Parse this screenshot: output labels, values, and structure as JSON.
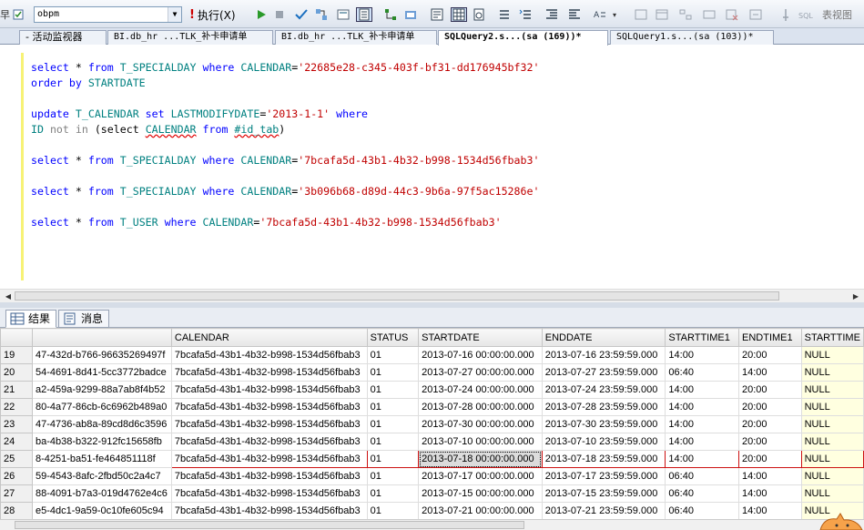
{
  "toolbar": {
    "left_glyph": "早",
    "database": "obpm",
    "execute_label": "执行(X)",
    "show_schema_label": "表视图"
  },
  "tabs": [
    {
      "label": "- 活动监视器",
      "active": false
    },
    {
      "label": "BI.db_hr ...TLK_补卡申请单",
      "active": false
    },
    {
      "label": "BI.db_hr ...TLK_补卡申请单",
      "active": false
    },
    {
      "label": "SQLQuery2.s...(sa (169))*",
      "active": true
    },
    {
      "label": "SQLQuery1.s...(sa (103))*",
      "active": false
    }
  ],
  "code_lines": [
    [
      [
        "kw",
        "select"
      ],
      [
        "",
        "*"
      ],
      [
        "kw",
        "from"
      ],
      [
        "id",
        "T_SPECIALDAY"
      ],
      [
        "kw",
        "where"
      ],
      [
        "id",
        "CALENDAR"
      ],
      [
        "",
        "="
      ],
      [
        "str",
        "'22685e28-c345-403f-bf31-dd176945bf32'"
      ]
    ],
    [
      [
        "kw",
        "order by"
      ],
      [
        "id",
        "STARTDATE"
      ]
    ],
    [],
    [
      [
        "kw",
        "update"
      ],
      [
        "id",
        "T_CALENDAR"
      ],
      [
        "kw",
        "set"
      ],
      [
        "id",
        "LASTMODIFYDATE"
      ],
      [
        "",
        "="
      ],
      [
        "str",
        "'2013-1-1'"
      ],
      [
        "kw",
        "where"
      ]
    ],
    [
      [
        "id",
        "ID"
      ],
      [
        "gr",
        "not in"
      ],
      [
        "",
        "(select"
      ],
      [
        "sqid",
        "CALENDAR"
      ],
      [
        "kw",
        "from"
      ],
      [
        "sqid",
        "#id_tab"
      ],
      [
        "",
        ")"
      ]
    ],
    [],
    [
      [
        "kw",
        "select"
      ],
      [
        "",
        "*"
      ],
      [
        "kw",
        "from"
      ],
      [
        "id",
        "T_SPECIALDAY"
      ],
      [
        "kw",
        "where"
      ],
      [
        "id",
        "CALENDAR"
      ],
      [
        "",
        "="
      ],
      [
        "str",
        "'7bcafa5d-43b1-4b32-b998-1534d56fbab3'"
      ]
    ],
    [],
    [
      [
        "kw",
        "select"
      ],
      [
        "",
        "*"
      ],
      [
        "kw",
        "from"
      ],
      [
        "id",
        "T_SPECIALDAY"
      ],
      [
        "kw",
        "where"
      ],
      [
        "id",
        "CALENDAR"
      ],
      [
        "",
        "="
      ],
      [
        "str",
        "'3b096b68-d89d-44c3-9b6a-97f5ac15286e'"
      ]
    ],
    [],
    [
      [
        "kw",
        "select"
      ],
      [
        "",
        "*"
      ],
      [
        "kw",
        "from"
      ],
      [
        "id",
        "T_USER"
      ],
      [
        "kw",
        "where"
      ],
      [
        "id",
        "CALENDAR"
      ],
      [
        "",
        "="
      ],
      [
        "str",
        "'7bcafa5d-43b1-4b32-b998-1534d56fbab3'"
      ]
    ]
  ],
  "results_tabs": {
    "results": "结果",
    "messages": "消息"
  },
  "grid": {
    "columns": [
      "",
      "CALENDAR",
      "STATUS",
      "STARTDATE",
      "ENDDATE",
      "STARTTIME1",
      "ENDTIME1",
      "STARTTIME"
    ],
    "rows": [
      [
        "19",
        "47-432d-b766-96635269497f",
        "7bcafa5d-43b1-4b32-b998-1534d56fbab3",
        "01",
        "2013-07-16 00:00:00.000",
        "2013-07-16 23:59:59.000",
        "14:00",
        "20:00",
        "NULL"
      ],
      [
        "20",
        "54-4691-8d41-5cc3772badce",
        "7bcafa5d-43b1-4b32-b998-1534d56fbab3",
        "01",
        "2013-07-27 00:00:00.000",
        "2013-07-27 23:59:59.000",
        "06:40",
        "14:00",
        "NULL"
      ],
      [
        "21",
        "a2-459a-9299-88a7ab8f4b52",
        "7bcafa5d-43b1-4b32-b998-1534d56fbab3",
        "01",
        "2013-07-24 00:00:00.000",
        "2013-07-24 23:59:59.000",
        "14:00",
        "20:00",
        "NULL"
      ],
      [
        "22",
        "80-4a77-86cb-6c6962b489a0",
        "7bcafa5d-43b1-4b32-b998-1534d56fbab3",
        "01",
        "2013-07-28 00:00:00.000",
        "2013-07-28 23:59:59.000",
        "14:00",
        "20:00",
        "NULL"
      ],
      [
        "23",
        "47-4736-ab8a-89cd8d6c3596",
        "7bcafa5d-43b1-4b32-b998-1534d56fbab3",
        "01",
        "2013-07-30 00:00:00.000",
        "2013-07-30 23:59:59.000",
        "14:00",
        "20:00",
        "NULL"
      ],
      [
        "24",
        "ba-4b38-b322-912fc15658fb",
        "7bcafa5d-43b1-4b32-b998-1534d56fbab3",
        "01",
        "2013-07-10 00:00:00.000",
        "2013-07-10 23:59:59.000",
        "14:00",
        "20:00",
        "NULL"
      ],
      [
        "25",
        "8-4251-ba51-fe464851118f",
        "7bcafa5d-43b1-4b32-b998-1534d56fbab3",
        "01",
        "2013-07-18 00:00:00.000",
        "2013-07-18 23:59:59.000",
        "14:00",
        "20:00",
        "NULL"
      ],
      [
        "26",
        "59-4543-8afc-2fbd50c2a4c7",
        "7bcafa5d-43b1-4b32-b998-1534d56fbab3",
        "01",
        "2013-07-17 00:00:00.000",
        "2013-07-17 23:59:59.000",
        "06:40",
        "14:00",
        "NULL"
      ],
      [
        "27",
        "88-4091-b7a3-019d4762e4c6",
        "7bcafa5d-43b1-4b32-b998-1534d56fbab3",
        "01",
        "2013-07-15 00:00:00.000",
        "2013-07-15 23:59:59.000",
        "06:40",
        "14:00",
        "NULL"
      ],
      [
        "28",
        "e5-4dc1-9a59-0c10fe605c94",
        "7bcafa5d-43b1-4b32-b998-1534d56fbab3",
        "01",
        "2013-07-21 00:00:00.000",
        "2013-07-21 23:59:59.000",
        "06:40",
        "14:00",
        "NULL"
      ]
    ],
    "selected_row": "25"
  },
  "colors": {
    "keyword": "#0000ff",
    "identifier": "#008080",
    "string": "#c00000",
    "null_cell": "#ffffe0",
    "selection_border": "#cc1111"
  }
}
